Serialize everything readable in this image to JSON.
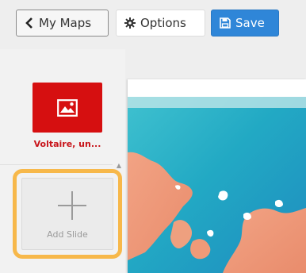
{
  "toolbar": {
    "back_label": "My Maps",
    "options_label": "Options",
    "save_label": "Save"
  },
  "sidebar": {
    "slides": [
      {
        "label": "Voltaire, un..."
      }
    ],
    "add_slide_label": "Add Slide"
  },
  "icons": {
    "back": "chevron-left-icon",
    "options": "gear-icon",
    "save": "floppy-disk-icon",
    "slide": "image-icon",
    "add": "plus-icon"
  },
  "colors": {
    "save_button": "#2f86d8",
    "slide_thumb": "#d60f10",
    "highlight": "#f7b84a"
  }
}
